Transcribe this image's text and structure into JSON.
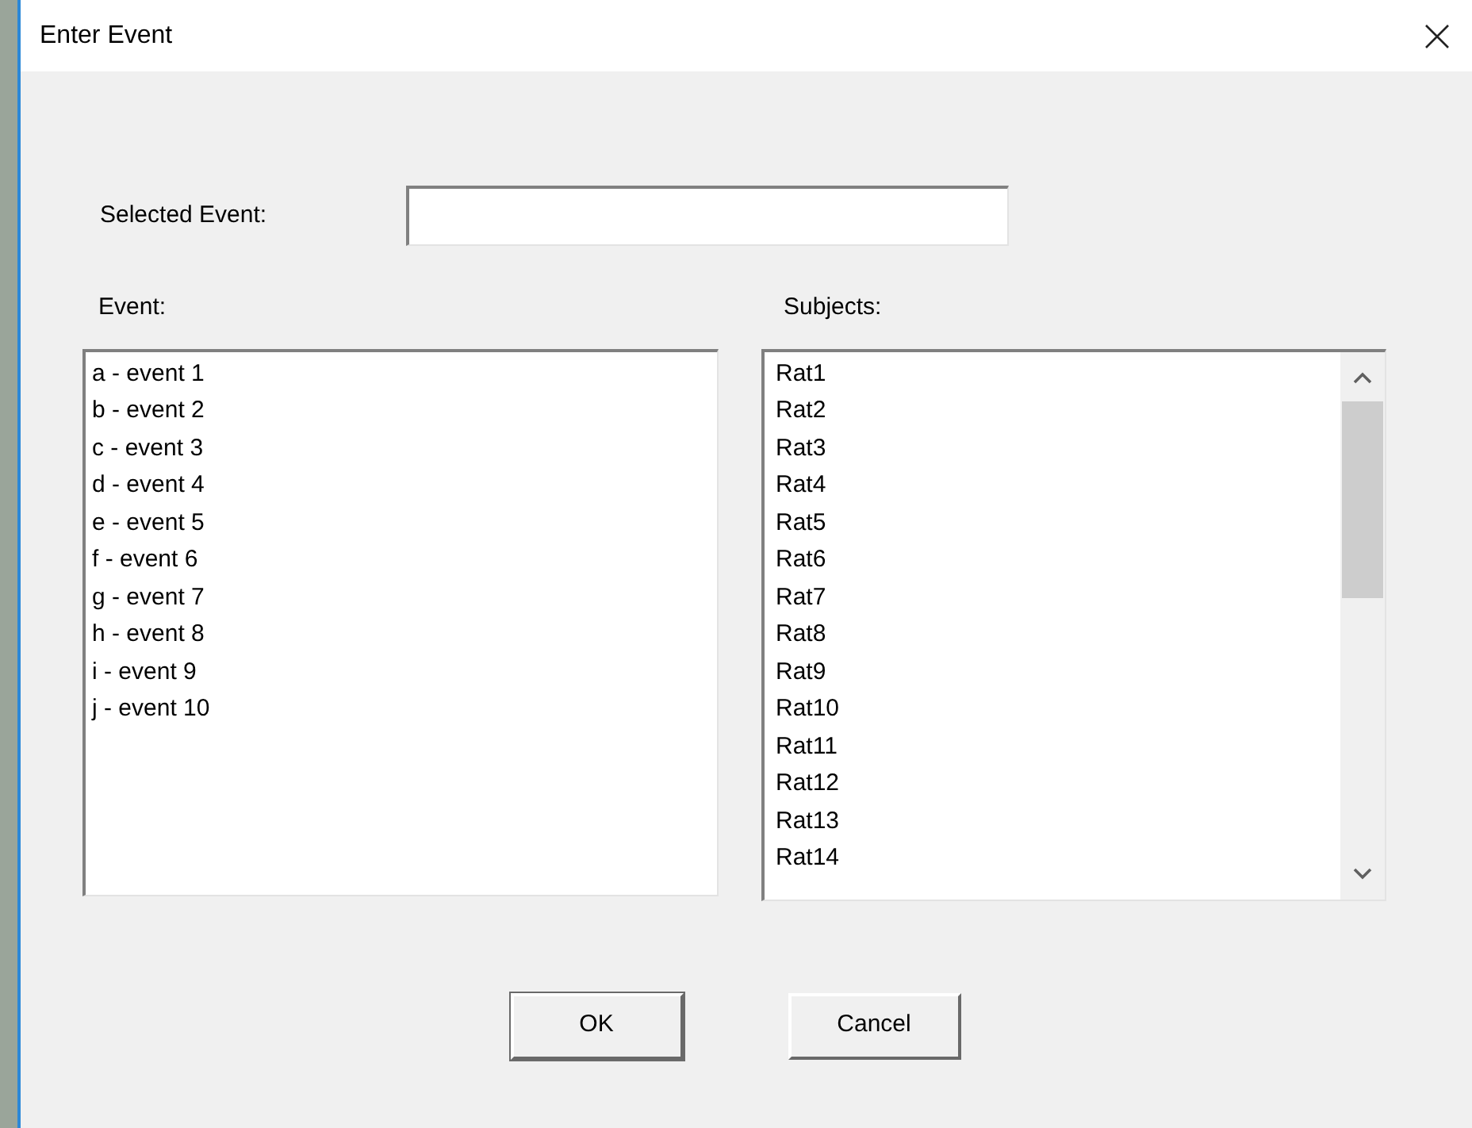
{
  "window": {
    "title": "Enter Event"
  },
  "selected_event": {
    "label": "Selected Event:"
  },
  "events": {
    "label": "Event:",
    "items": [
      {
        "text": "a - event 1",
        "selected": false
      },
      {
        "text": "b - event 2",
        "selected": false
      },
      {
        "text": "c - event 3",
        "selected": false
      },
      {
        "text": "d - event 4",
        "selected": false
      },
      {
        "text": "e - event 5",
        "selected": false
      },
      {
        "text": "f - event 6",
        "selected": false
      },
      {
        "text": "g - event 7",
        "selected": false
      },
      {
        "text": "h - event 8",
        "selected": false
      },
      {
        "text": "i - event 9",
        "selected": false
      },
      {
        "text": "j - event 10",
        "selected": false
      }
    ]
  },
  "subjects": {
    "label": "Subjects:",
    "items": [
      {
        "text": "Rat1",
        "selected": false
      },
      {
        "text": "Rat2",
        "selected": false
      },
      {
        "text": "Rat3",
        "selected": false
      },
      {
        "text": "Rat4",
        "selected": false
      },
      {
        "text": "Rat5",
        "selected": false
      },
      {
        "text": "Rat6",
        "selected": false
      },
      {
        "text": "Rat7",
        "selected": false
      },
      {
        "text": "Rat8",
        "selected": false
      },
      {
        "text": "Rat9",
        "selected": false
      },
      {
        "text": "Rat10",
        "selected": false
      },
      {
        "text": "Rat11",
        "selected": false
      },
      {
        "text": "Rat12",
        "selected": false
      },
      {
        "text": "Rat13",
        "selected": false
      },
      {
        "text": "Rat14",
        "selected": false
      }
    ]
  },
  "buttons": [
    {
      "label": "OK",
      "default": true
    },
    {
      "label": "Cancel",
      "default": false
    }
  ]
}
